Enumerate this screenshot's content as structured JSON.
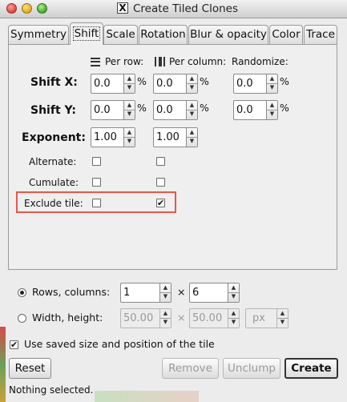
{
  "window": {
    "title": "Create Tiled Clones",
    "app_icon": "x-icon"
  },
  "tabs": [
    {
      "label": "Symmetry",
      "active": false
    },
    {
      "label": "Shift",
      "active": true
    },
    {
      "label": "Scale",
      "active": false
    },
    {
      "label": "Rotation",
      "active": false
    },
    {
      "label": "Blur & opacity",
      "active": false
    },
    {
      "label": "Color",
      "active": false
    },
    {
      "label": "Trace",
      "active": false
    }
  ],
  "columns": {
    "per_row": "Per row:",
    "per_column": "Per column:",
    "randomize": "Randomize:"
  },
  "shift_x": {
    "label": "Shift X:",
    "per_row": "0.0",
    "per_column": "0.0",
    "randomize": "0.0",
    "unit": "%"
  },
  "shift_y": {
    "label": "Shift Y:",
    "per_row": "0.0",
    "per_column": "0.0",
    "randomize": "0.0",
    "unit": "%"
  },
  "exponent": {
    "label": "Exponent:",
    "per_row": "1.00",
    "per_column": "1.00"
  },
  "alternate": {
    "label": "Alternate:",
    "per_row": false,
    "per_column": false
  },
  "cumulate": {
    "label": "Cumulate:",
    "per_row": false,
    "per_column": false
  },
  "exclude_tile": {
    "label": "Exclude tile:",
    "per_row": false,
    "per_column": true,
    "check_mark": "✔"
  },
  "highlight_color": "#e8574a",
  "rows_columns": {
    "label": "Rows, columns:",
    "selected": true,
    "rows": "1",
    "times": "×",
    "columns": "6"
  },
  "width_height": {
    "label": "Width, height:",
    "selected": false,
    "width": "50.00",
    "times": "×",
    "height": "50.00",
    "unit": "px"
  },
  "use_saved": {
    "label": "Use saved size and position of the tile",
    "checked": true,
    "check_mark": "✔"
  },
  "buttons": {
    "reset": "Reset",
    "remove": "Remove",
    "unclump": "Unclump",
    "create": "Create"
  },
  "status": "Nothing selected."
}
